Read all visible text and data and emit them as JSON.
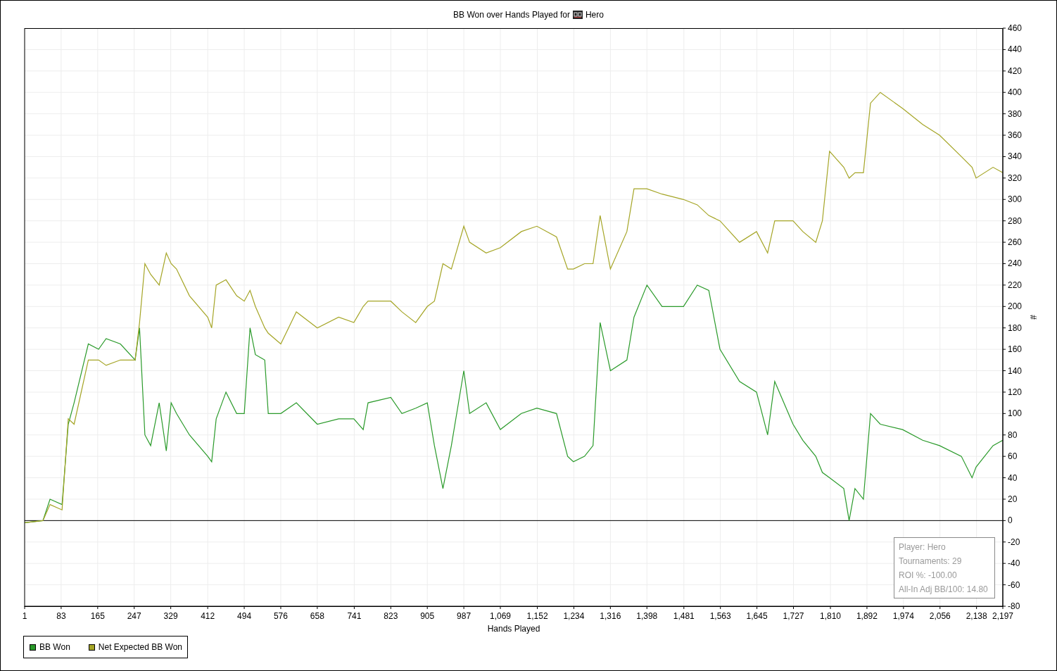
{
  "chart": {
    "player_name": "Hero",
    "chart_data": {
      "type": "line",
      "grid": true,
      "title": "BB Won over Hands Played for",
      "xlabel": "Hands Played",
      "ylabel": "#",
      "x": [
        1,
        42,
        58,
        85,
        99,
        112,
        144,
        167,
        184,
        216,
        249,
        259,
        271,
        284,
        303,
        319,
        330,
        342,
        371,
        412,
        421,
        431,
        453,
        477,
        494,
        507,
        519,
        540,
        548,
        576,
        611,
        658,
        706,
        740,
        761,
        772,
        823,
        848,
        879,
        905,
        921,
        940,
        959,
        987,
        1000,
        1037,
        1069,
        1116,
        1151,
        1195,
        1220,
        1233,
        1258,
        1277,
        1293,
        1316,
        1353,
        1369,
        1398,
        1432,
        1480,
        1511,
        1537,
        1562,
        1606,
        1644,
        1669,
        1685,
        1726,
        1748,
        1777,
        1792,
        1808,
        1840,
        1852,
        1865,
        1884,
        1900,
        1922,
        1972,
        2017,
        2055,
        2104,
        2128,
        2137,
        2175,
        2197
      ],
      "series": [
        {
          "name": "BB Won",
          "color": "#2a9a2a",
          "values": [
            -2,
            0,
            20,
            15,
            90,
            110,
            165,
            160,
            170,
            165,
            150,
            180,
            80,
            70,
            110,
            65,
            110,
            100,
            80,
            60,
            55,
            95,
            120,
            100,
            100,
            180,
            155,
            150,
            100,
            100,
            110,
            90,
            95,
            95,
            85,
            110,
            115,
            100,
            105,
            110,
            70,
            30,
            70,
            140,
            100,
            110,
            85,
            100,
            105,
            100,
            60,
            55,
            60,
            70,
            185,
            140,
            150,
            190,
            220,
            200,
            200,
            220,
            215,
            160,
            130,
            120,
            80,
            130,
            90,
            75,
            60,
            45,
            40,
            30,
            0,
            30,
            20,
            100,
            90,
            85,
            75,
            70,
            60,
            40,
            50,
            70,
            75
          ]
        },
        {
          "name": "Net Expected BB Won",
          "color": "#a5a526",
          "values": [
            -2,
            0,
            15,
            10,
            95,
            90,
            150,
            150,
            145,
            150,
            150,
            185,
            240,
            230,
            220,
            250,
            240,
            235,
            210,
            190,
            180,
            220,
            225,
            210,
            205,
            215,
            200,
            180,
            175,
            165,
            195,
            180,
            190,
            185,
            200,
            205,
            205,
            195,
            185,
            200,
            205,
            240,
            235,
            275,
            260,
            250,
            255,
            270,
            275,
            265,
            235,
            235,
            240,
            240,
            285,
            235,
            270,
            310,
            310,
            305,
            300,
            295,
            285,
            280,
            260,
            270,
            250,
            280,
            280,
            270,
            260,
            280,
            345,
            330,
            320,
            325,
            325,
            390,
            400,
            385,
            370,
            360,
            340,
            330,
            320,
            330,
            325
          ]
        }
      ],
      "xlim": [
        1,
        2197
      ],
      "ylim": [
        -80,
        460
      ],
      "xticks": [
        {
          "value": 1,
          "label": "1"
        },
        {
          "value": 83,
          "label": "83"
        },
        {
          "value": 165,
          "label": "165"
        },
        {
          "value": 247,
          "label": "247"
        },
        {
          "value": 329,
          "label": "329"
        },
        {
          "value": 412,
          "label": "412"
        },
        {
          "value": 494,
          "label": "494"
        },
        {
          "value": 576,
          "label": "576"
        },
        {
          "value": 658,
          "label": "658"
        },
        {
          "value": 741,
          "label": "741"
        },
        {
          "value": 823,
          "label": "823"
        },
        {
          "value": 905,
          "label": "905"
        },
        {
          "value": 987,
          "label": "987"
        },
        {
          "value": 1069,
          "label": "1,069"
        },
        {
          "value": 1152,
          "label": "1,152"
        },
        {
          "value": 1234,
          "label": "1,234"
        },
        {
          "value": 1316,
          "label": "1,316"
        },
        {
          "value": 1398,
          "label": "1,398"
        },
        {
          "value": 1481,
          "label": "1,481"
        },
        {
          "value": 1563,
          "label": "1,563"
        },
        {
          "value": 1645,
          "label": "1,645"
        },
        {
          "value": 1727,
          "label": "1,727"
        },
        {
          "value": 1810,
          "label": "1,810"
        },
        {
          "value": 1892,
          "label": "1,892"
        },
        {
          "value": 1974,
          "label": "1,974"
        },
        {
          "value": 2056,
          "label": "2,056"
        },
        {
          "value": 2138,
          "label": "2,138"
        },
        {
          "value": 2197,
          "label": "2,197"
        }
      ],
      "yticks": [
        -80,
        -60,
        -40,
        -20,
        0,
        20,
        40,
        60,
        80,
        100,
        120,
        140,
        160,
        180,
        200,
        220,
        240,
        260,
        280,
        300,
        320,
        340,
        360,
        380,
        400,
        420,
        440,
        460
      ]
    },
    "info_box": [
      "Player: Hero",
      "Tournaments: 29",
      "ROI %: -100.00",
      "All-In Adj BB/100: 14.80"
    ]
  }
}
